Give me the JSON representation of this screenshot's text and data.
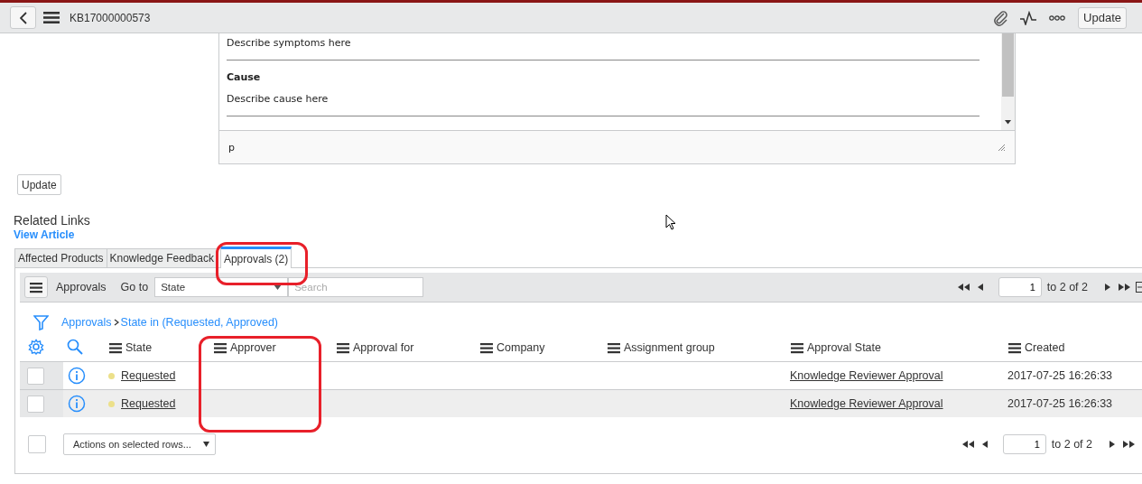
{
  "header": {
    "title": "KB17000000573",
    "update_button": "Update"
  },
  "editor": {
    "lines": [
      {
        "kind": "text",
        "text": "Describe symptoms here"
      },
      {
        "kind": "rule"
      },
      {
        "kind": "heading",
        "text": "Cause"
      },
      {
        "kind": "text",
        "text": "Describe cause here"
      },
      {
        "kind": "rule"
      }
    ],
    "path": "p"
  },
  "update_button": "Update",
  "related_links": {
    "title": "Related Links",
    "links": [
      "View Article"
    ]
  },
  "tabs": [
    {
      "label": "Affected Products",
      "selected": false
    },
    {
      "label": "Knowledge Feedback",
      "selected": false
    },
    {
      "label": "Approvals (2)",
      "selected": true
    }
  ],
  "list": {
    "toolbar": {
      "title": "Approvals",
      "goto_label": "Go to",
      "goto_field": "State",
      "search_placeholder": "Search",
      "page": "1",
      "range": "to 2 of 2"
    },
    "breadcrumb": [
      "Approvals",
      "State in (Requested, Approved)"
    ],
    "columns": [
      "State",
      "Approver",
      "Approval for",
      "Company",
      "Assignment group",
      "Approval State",
      "Created"
    ],
    "rows": [
      {
        "checked": false,
        "state": "Requested",
        "color": "#ece08a",
        "approval_state": "Knowledge Reviewer Approval",
        "created": "2017-07-25 16:26:33"
      },
      {
        "checked": false,
        "state": "Requested",
        "color": "#ece08a",
        "approval_state": "Knowledge Reviewer Approval",
        "created": "2017-07-25 16:26:33"
      }
    ],
    "footer": {
      "checked": false,
      "actions": "Actions on selected rows...",
      "page": "1",
      "range": "to 2 of 2"
    }
  }
}
